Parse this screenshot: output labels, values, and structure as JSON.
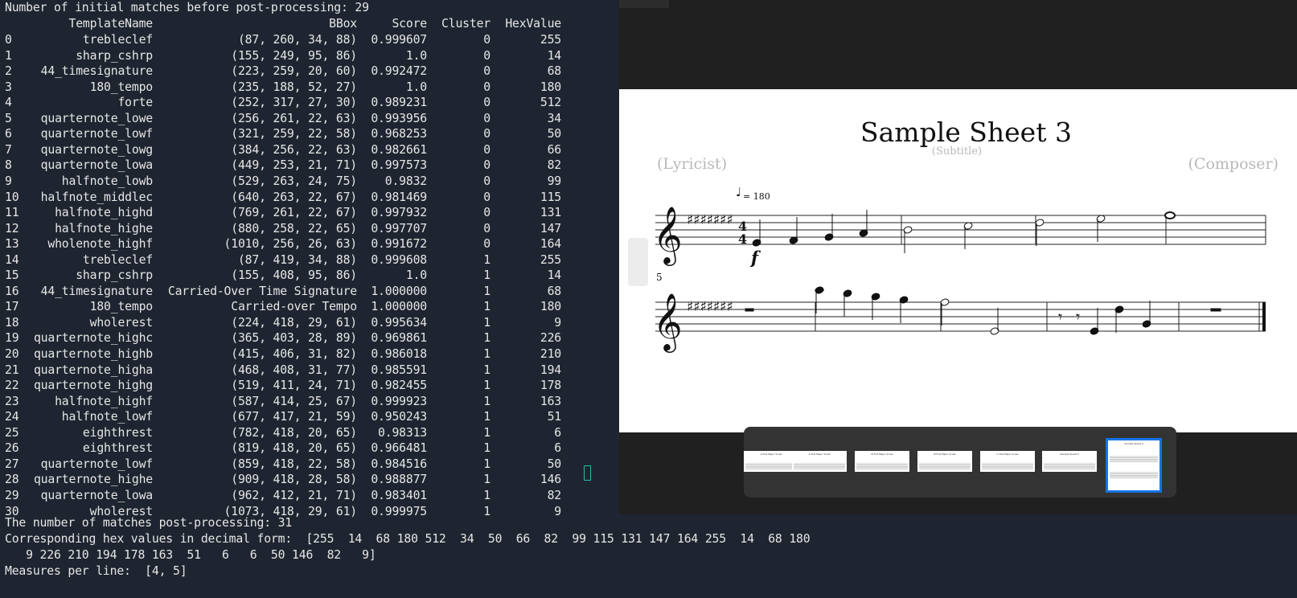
{
  "terminal": {
    "header_line": "Number of initial matches before post-processing: 29",
    "columns": {
      "name": "TemplateName",
      "bbox": "BBox",
      "score": "Score",
      "cluster": "Cluster",
      "hex": "HexValue"
    },
    "rows": [
      {
        "idx": "0",
        "name": "trebleclef",
        "bbox": "(87, 260, 34, 88)",
        "score": "0.999607",
        "cluster": "0",
        "hex": "255"
      },
      {
        "idx": "1",
        "name": "sharp_cshrp",
        "bbox": "(155, 249, 95, 86)",
        "score": "1.0",
        "cluster": "0",
        "hex": "14"
      },
      {
        "idx": "2",
        "name": "44_timesignature",
        "bbox": "(223, 259, 20, 60)",
        "score": "0.992472",
        "cluster": "0",
        "hex": "68"
      },
      {
        "idx": "3",
        "name": "180_tempo",
        "bbox": "(235, 188, 52, 27)",
        "score": "1.0",
        "cluster": "0",
        "hex": "180"
      },
      {
        "idx": "4",
        "name": "forte",
        "bbox": "(252, 317, 27, 30)",
        "score": "0.989231",
        "cluster": "0",
        "hex": "512"
      },
      {
        "idx": "5",
        "name": "quarternote_lowe",
        "bbox": "(256, 261, 22, 63)",
        "score": "0.993956",
        "cluster": "0",
        "hex": "34"
      },
      {
        "idx": "6",
        "name": "quarternote_lowf",
        "bbox": "(321, 259, 22, 58)",
        "score": "0.968253",
        "cluster": "0",
        "hex": "50"
      },
      {
        "idx": "7",
        "name": "quarternote_lowg",
        "bbox": "(384, 256, 22, 63)",
        "score": "0.982661",
        "cluster": "0",
        "hex": "66"
      },
      {
        "idx": "8",
        "name": "quarternote_lowa",
        "bbox": "(449, 253, 21, 71)",
        "score": "0.997573",
        "cluster": "0",
        "hex": "82"
      },
      {
        "idx": "9",
        "name": "halfnote_lowb",
        "bbox": "(529, 263, 24, 75)",
        "score": "0.9832",
        "cluster": "0",
        "hex": "99"
      },
      {
        "idx": "10",
        "name": "halfnote_middlec",
        "bbox": "(640, 263, 22, 67)",
        "score": "0.981469",
        "cluster": "0",
        "hex": "115"
      },
      {
        "idx": "11",
        "name": "halfnote_highd",
        "bbox": "(769, 261, 22, 67)",
        "score": "0.997932",
        "cluster": "0",
        "hex": "131"
      },
      {
        "idx": "12",
        "name": "halfnote_highe",
        "bbox": "(880, 258, 22, 65)",
        "score": "0.997707",
        "cluster": "0",
        "hex": "147"
      },
      {
        "idx": "13",
        "name": "wholenote_highf",
        "bbox": "(1010, 256, 26, 63)",
        "score": "0.991672",
        "cluster": "0",
        "hex": "164"
      },
      {
        "idx": "14",
        "name": "trebleclef",
        "bbox": "(87, 419, 34, 88)",
        "score": "0.999608",
        "cluster": "1",
        "hex": "255"
      },
      {
        "idx": "15",
        "name": "sharp_cshrp",
        "bbox": "(155, 408, 95, 86)",
        "score": "1.0",
        "cluster": "1",
        "hex": "14"
      },
      {
        "idx": "16",
        "name": "44_timesignature",
        "bbox": "Carried-Over Time Signature",
        "score": "1.000000",
        "cluster": "1",
        "hex": "68"
      },
      {
        "idx": "17",
        "name": "180_tempo",
        "bbox": "Carried-over Tempo",
        "score": "1.000000",
        "cluster": "1",
        "hex": "180"
      },
      {
        "idx": "18",
        "name": "wholerest",
        "bbox": "(224, 418, 29, 61)",
        "score": "0.995634",
        "cluster": "1",
        "hex": "9"
      },
      {
        "idx": "19",
        "name": "quarternote_highc",
        "bbox": "(365, 403, 28, 89)",
        "score": "0.969861",
        "cluster": "1",
        "hex": "226"
      },
      {
        "idx": "20",
        "name": "quarternote_highb",
        "bbox": "(415, 406, 31, 82)",
        "score": "0.986018",
        "cluster": "1",
        "hex": "210"
      },
      {
        "idx": "21",
        "name": "quarternote_higha",
        "bbox": "(468, 408, 31, 77)",
        "score": "0.985591",
        "cluster": "1",
        "hex": "194"
      },
      {
        "idx": "22",
        "name": "quarternote_highg",
        "bbox": "(519, 411, 24, 71)",
        "score": "0.982455",
        "cluster": "1",
        "hex": "178"
      },
      {
        "idx": "23",
        "name": "halfnote_highf",
        "bbox": "(587, 414, 25, 67)",
        "score": "0.999923",
        "cluster": "1",
        "hex": "163"
      },
      {
        "idx": "24",
        "name": "halfnote_lowf",
        "bbox": "(677, 417, 21, 59)",
        "score": "0.950243",
        "cluster": "1",
        "hex": "51"
      },
      {
        "idx": "25",
        "name": "eighthrest",
        "bbox": "(782, 418, 20, 65)",
        "score": "0.98313",
        "cluster": "1",
        "hex": "6"
      },
      {
        "idx": "26",
        "name": "eighthrest",
        "bbox": "(819, 418, 20, 65)",
        "score": "0.966481",
        "cluster": "1",
        "hex": "6"
      },
      {
        "idx": "27",
        "name": "quarternote_lowf",
        "bbox": "(859, 418, 22, 58)",
        "score": "0.984516",
        "cluster": "1",
        "hex": "50"
      },
      {
        "idx": "28",
        "name": "quarternote_highe",
        "bbox": "(909, 418, 28, 58)",
        "score": "0.988877",
        "cluster": "1",
        "hex": "146"
      },
      {
        "idx": "29",
        "name": "quarternote_lowa",
        "bbox": "(962, 412, 21, 71)",
        "score": "0.983401",
        "cluster": "1",
        "hex": "82"
      },
      {
        "idx": "30",
        "name": "wholerest",
        "bbox": "(1073, 418, 29, 61)",
        "score": "0.999975",
        "cluster": "1",
        "hex": "9"
      }
    ],
    "post_count_line": "The number of matches post-processing: 31",
    "hex_line_1": "Corresponding hex values in decimal form:  [255  14  68 180 512  34  50  66  82  99 115 131 147 164 255  14  68 180",
    "hex_line_2": "   9 226 210 194 178 163  51   6   6  50 146  82   9]",
    "measures_line": "Measures per line:  [4, 5]"
  },
  "viewer": {
    "sheet": {
      "title": "Sample Sheet 3",
      "subtitle": "(Subtitle)",
      "lyricist": "(Lyricist)",
      "composer": "(Composer)",
      "tempo_value": "= 180",
      "measure_number": "5",
      "dynamic": "f"
    },
    "thumbnails": [
      {
        "label": "A Flat Major Scale",
        "active": false
      },
      {
        "label": "A Flat Major Scale",
        "active": false
      },
      {
        "label": "B Flat Major Scale",
        "active": false
      },
      {
        "label": "B Flat Major Scale",
        "active": false
      },
      {
        "label": "C Flat Major Scale",
        "active": false
      },
      {
        "label": "Sample Sheet 2",
        "active": false
      },
      {
        "label": "Sample Sheet 3",
        "active": true
      }
    ]
  },
  "colors": {
    "terminal_bg": "#1e2530",
    "terminal_text": "#e6e6e6",
    "cursor": "#2bb6a8",
    "viewer_bg": "#202020",
    "active_thumb": "#1473e6"
  }
}
